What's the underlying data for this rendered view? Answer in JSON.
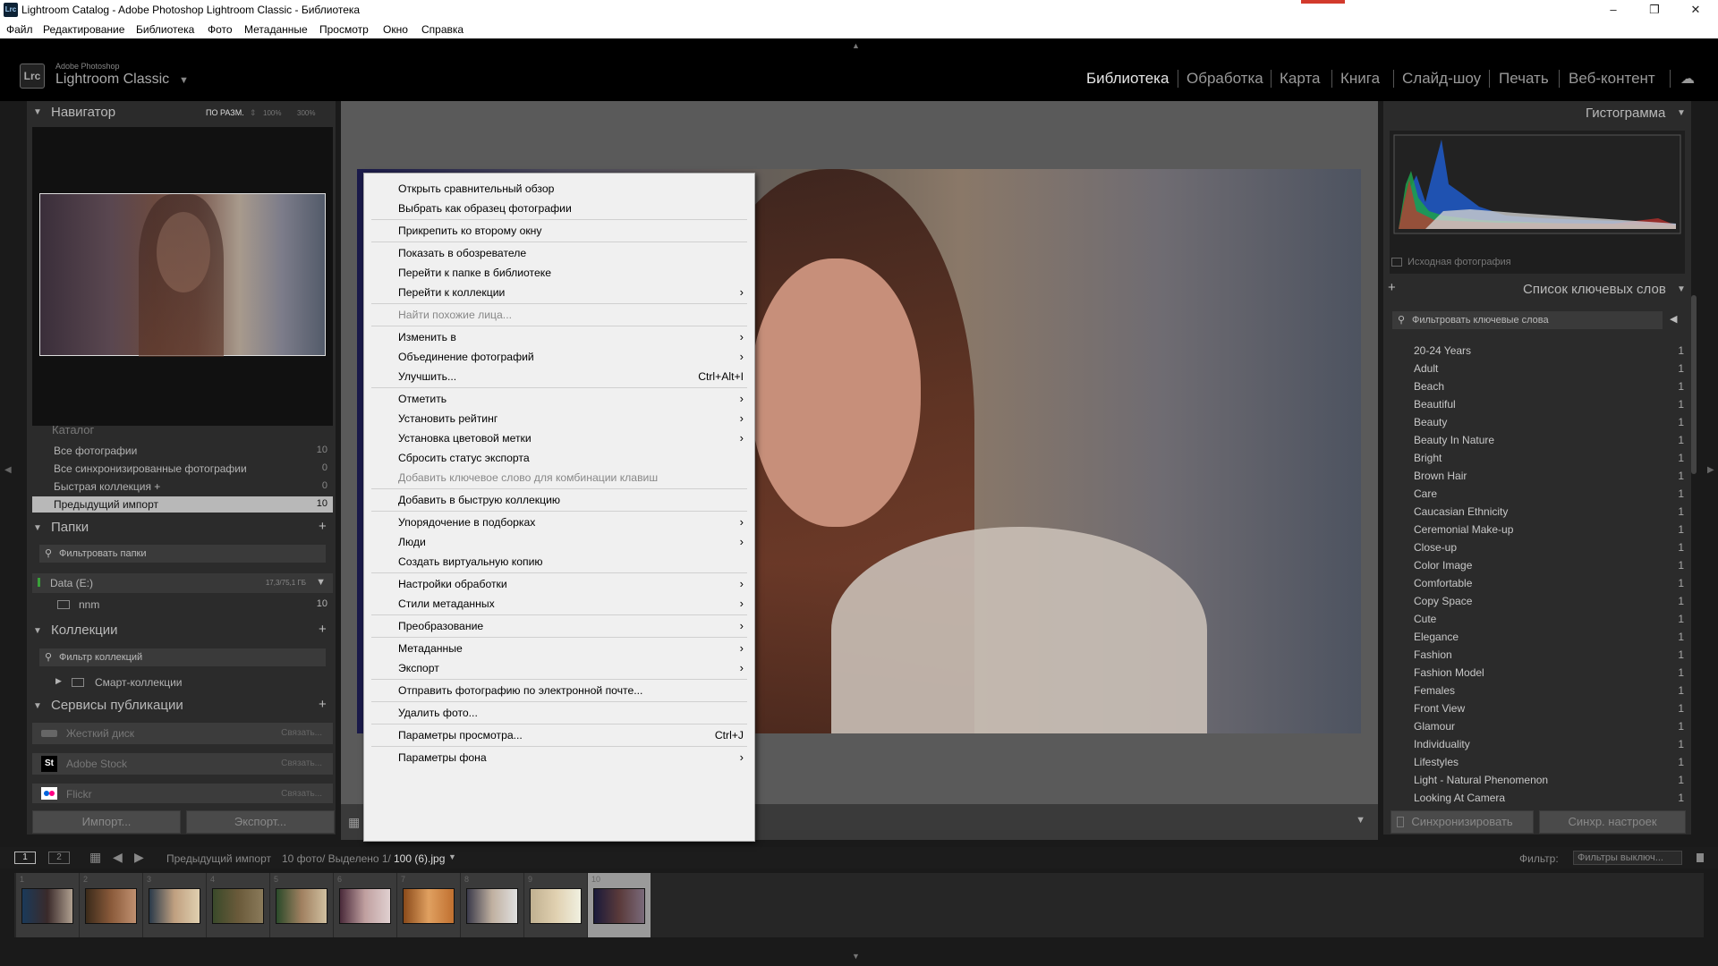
{
  "window": {
    "title": "Lightroom Catalog - Adobe Photoshop Lightroom Classic - Библиотека",
    "app_icon": "Lrc",
    "minimize": "–",
    "maximize": "❐",
    "close": "✕"
  },
  "menubar": [
    "Файл",
    "Редактирование",
    "Библиотека",
    "Фото",
    "Метаданные",
    "Просмотр",
    "Окно",
    "Справка"
  ],
  "brand": {
    "logo": "Lrc",
    "line1": "Adobe Photoshop",
    "line2": "Lightroom Classic",
    "caret": "▼"
  },
  "modules": [
    "Библиотека",
    "Обработка",
    "Карта",
    "Книга",
    "Слайд-шоу",
    "Печать",
    "Веб-контент"
  ],
  "navigator": {
    "title": "Навигатор",
    "zoom_fit": "ПО РАЗМ.",
    "zoom_100": "100%",
    "zoom_300": "300%"
  },
  "catalog": {
    "title": "Каталог",
    "items": [
      {
        "label": "Все фотографии",
        "count": "10"
      },
      {
        "label": "Все синхронизированные фотографии",
        "count": "0"
      },
      {
        "label": "Быстрая коллекция +",
        "count": "0"
      },
      {
        "label": "Предыдущий импорт",
        "count": "10"
      }
    ]
  },
  "folders": {
    "title": "Папки",
    "filter": "Фильтровать папки",
    "volume": "Data (E:)",
    "volume_size": "17,3/75,1 ГБ",
    "folder": "nnm",
    "folder_count": "10"
  },
  "collections": {
    "title": "Коллекции",
    "filter": "Фильтр коллекций",
    "smart": "Смарт-коллекции"
  },
  "publish": {
    "title": "Сервисы публикации",
    "services": [
      {
        "name": "Жесткий диск",
        "action": "Связать..."
      },
      {
        "name": "Adobe Stock",
        "action": "Связать..."
      },
      {
        "name": "Flickr",
        "action": "Связать..."
      }
    ]
  },
  "left_buttons": {
    "import": "Импорт...",
    "export": "Экспорт..."
  },
  "histogram": {
    "title": "Гистограмма",
    "original": "Исходная фотография"
  },
  "keywords": {
    "title": "Список ключевых слов",
    "filter": "Фильтровать ключевые слова",
    "items": [
      {
        "label": "20-24 Years",
        "count": "1"
      },
      {
        "label": "Adult",
        "count": "1"
      },
      {
        "label": "Beach",
        "count": "1"
      },
      {
        "label": "Beautiful",
        "count": "1"
      },
      {
        "label": "Beauty",
        "count": "1"
      },
      {
        "label": "Beauty In Nature",
        "count": "1"
      },
      {
        "label": "Bright",
        "count": "1"
      },
      {
        "label": "Brown Hair",
        "count": "1"
      },
      {
        "label": "Care",
        "count": "1"
      },
      {
        "label": "Caucasian Ethnicity",
        "count": "1"
      },
      {
        "label": "Ceremonial Make-up",
        "count": "1"
      },
      {
        "label": "Close-up",
        "count": "1"
      },
      {
        "label": "Color Image",
        "count": "1"
      },
      {
        "label": "Comfortable",
        "count": "1"
      },
      {
        "label": "Copy Space",
        "count": "1"
      },
      {
        "label": "Cute",
        "count": "1"
      },
      {
        "label": "Elegance",
        "count": "1"
      },
      {
        "label": "Fashion",
        "count": "1"
      },
      {
        "label": "Fashion Model",
        "count": "1"
      },
      {
        "label": "Females",
        "count": "1"
      },
      {
        "label": "Front View",
        "count": "1"
      },
      {
        "label": "Glamour",
        "count": "1"
      },
      {
        "label": "Individuality",
        "count": "1"
      },
      {
        "label": "Lifestyles",
        "count": "1"
      },
      {
        "label": "Light - Natural Phenomenon",
        "count": "1"
      },
      {
        "label": "Looking At Camera",
        "count": "1"
      }
    ]
  },
  "right_buttons": {
    "sync": "Синхронизировать",
    "sync_settings": "Синхр. настроек"
  },
  "context_menu": [
    {
      "label": "Открыть сравнительный обзор"
    },
    {
      "label": "Выбрать как образец фотографии"
    },
    {
      "sep": true
    },
    {
      "label": "Прикрепить ко второму окну"
    },
    {
      "sep": true
    },
    {
      "label": "Показать в обозревателе"
    },
    {
      "label": "Перейти к папке в библиотеке"
    },
    {
      "label": "Перейти к коллекции",
      "arrow": true
    },
    {
      "sep": true
    },
    {
      "label": "Найти похожие лица...",
      "disabled": true
    },
    {
      "sep": true
    },
    {
      "label": "Изменить в",
      "arrow": true
    },
    {
      "label": "Объединение фотографий",
      "arrow": true
    },
    {
      "label": "Улучшить...",
      "shortcut": "Ctrl+Alt+I"
    },
    {
      "sep": true
    },
    {
      "label": "Отметить",
      "arrow": true
    },
    {
      "label": "Установить рейтинг",
      "arrow": true
    },
    {
      "label": "Установка цветовой метки",
      "arrow": true
    },
    {
      "label": "Сбросить статус экспорта"
    },
    {
      "label": "Добавить ключевое слово для комбинации клавиш",
      "disabled": true
    },
    {
      "sep": true
    },
    {
      "label": "Добавить в быструю коллекцию"
    },
    {
      "sep": true
    },
    {
      "label": "Упорядочение в подборках",
      "arrow": true
    },
    {
      "label": "Люди",
      "arrow": true
    },
    {
      "label": "Создать виртуальную копию"
    },
    {
      "sep": true
    },
    {
      "label": "Настройки обработки",
      "arrow": true
    },
    {
      "label": "Стили метаданных",
      "arrow": true
    },
    {
      "sep": true
    },
    {
      "label": "Преобразование",
      "arrow": true
    },
    {
      "sep": true
    },
    {
      "label": "Метаданные",
      "arrow": true
    },
    {
      "label": "Экспорт",
      "arrow": true
    },
    {
      "sep": true
    },
    {
      "label": "Отправить фотографию по электронной почте..."
    },
    {
      "sep": true
    },
    {
      "label": "Удалить фото..."
    },
    {
      "sep": true
    },
    {
      "label": "Параметры просмотра...",
      "shortcut": "Ctrl+J"
    },
    {
      "sep": true
    },
    {
      "label": "Параметры фона",
      "arrow": true
    }
  ],
  "filmstrip_bar": {
    "page1": "1",
    "page2": "2",
    "source": "Предыдущий импорт",
    "info": "10 фото/ Выделено 1/",
    "file": "100 (6).jpg",
    "filter_label": "Фильтр:",
    "filter_value": "Фильтры выключ..."
  },
  "filmstrip": {
    "numbers": [
      "1",
      "2",
      "3",
      "4",
      "5",
      "6",
      "7",
      "8",
      "9",
      "10"
    ],
    "selected_index": 9
  },
  "colors": {
    "accent_blue": "#1f5fd6",
    "hist_green": "#1fa24a",
    "hist_red": "#c8322d"
  }
}
